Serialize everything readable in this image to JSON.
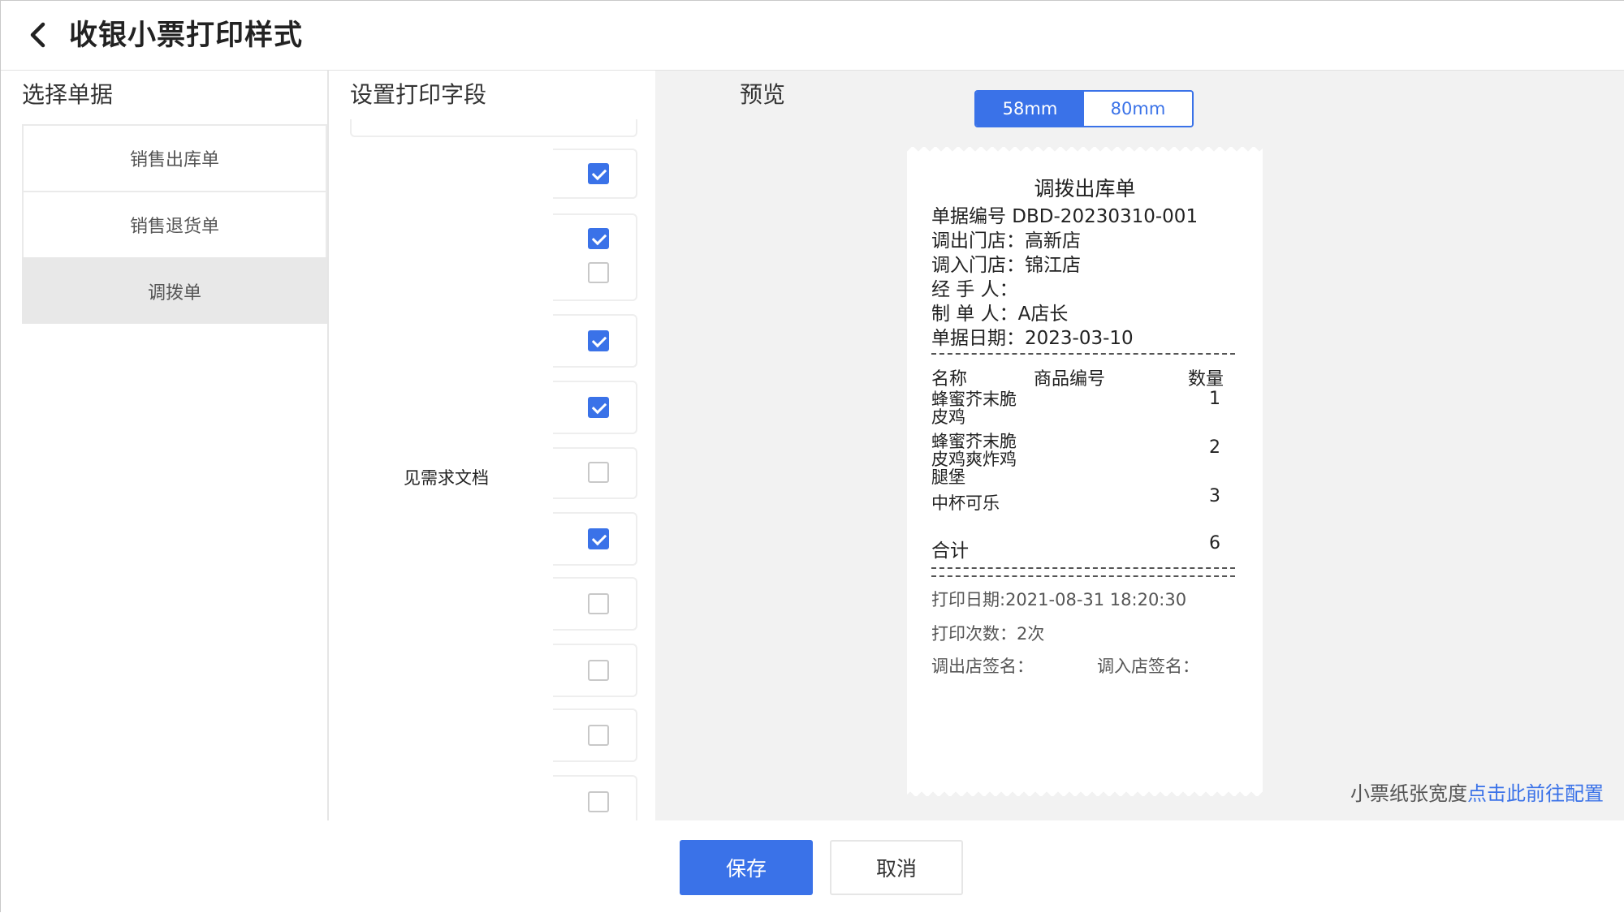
{
  "header": {
    "title": "收银小票打印样式"
  },
  "left_panel": {
    "section_title": "选择单据",
    "doc_types": [
      "销售出库单",
      "销售退货单",
      "调拨单"
    ]
  },
  "mid_panel": {
    "section_title": "设置打印字段",
    "requirement_note": "见需求文档",
    "checkboxes": [
      true,
      true,
      false,
      true,
      true,
      false,
      true,
      false,
      false,
      false,
      false
    ]
  },
  "preview": {
    "section_title": "预览",
    "width_options": [
      "58mm",
      "80mm"
    ],
    "selected_width": "58mm",
    "receipt": {
      "title": "调拨出库单",
      "doc_no": "单据编号 DBD-20230310-001",
      "out_store": "调出门店：高新店",
      "in_store": "调入门店：锦江店",
      "handler": "经  手  人：",
      "maker": "制  单  人：A店长",
      "date": "单据日期：2023-03-10",
      "col_name": "名称",
      "col_code": "商品编号",
      "col_qty": "数量",
      "items": [
        {
          "name": "蜂蜜芥末脆皮鸡",
          "qty": "1"
        },
        {
          "name": "蜂蜜芥末脆皮鸡爽炸鸡腿堡",
          "qty": "2"
        },
        {
          "name": "中杯可乐",
          "qty": "3"
        }
      ],
      "total_label": "合计",
      "total_qty": "6",
      "print_date": "打印日期:2021-08-31 18:20:30",
      "print_count": "打印次数：2次",
      "sign_out": "调出店签名：",
      "sign_in": "调入店签名："
    },
    "paper_note": "小票纸张宽度",
    "paper_link": "点击此前往配置"
  },
  "footer": {
    "save_label": "保存",
    "cancel_label": "取消"
  },
  "colors": {
    "accent": "#3a72e8",
    "selected_bg": "#e8e8e8",
    "preview_bg": "#f2f2f2"
  }
}
